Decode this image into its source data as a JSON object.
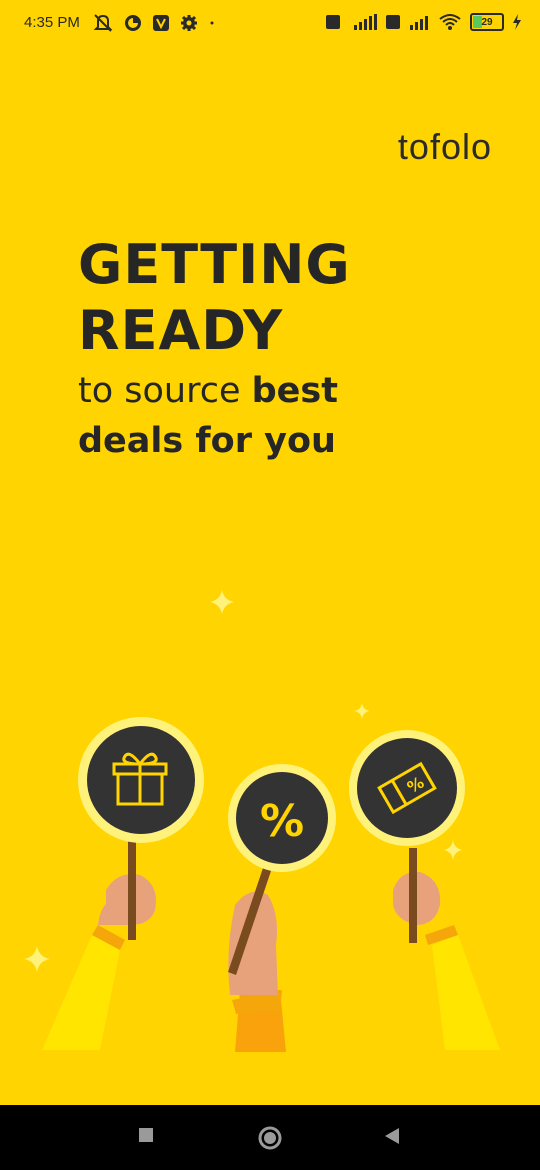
{
  "status_bar": {
    "time": "4:35 PM",
    "battery_level": "29",
    "icons": [
      "mute-icon",
      "app-icon",
      "v-icon",
      "settings-icon",
      "volte-icon",
      "signal-icon",
      "wifi-icon",
      "battery-icon",
      "charging-icon"
    ]
  },
  "brand": {
    "name": "tofolo"
  },
  "headline": {
    "line1": "GETTING",
    "line2": "READY",
    "sub_regular_1": "to source ",
    "sub_bold_1": "best",
    "sub_bold_2": "deals for you"
  },
  "illustration": {
    "signs": [
      "gift-icon",
      "percent-icon",
      "coupon-icon"
    ],
    "percent_symbol": "%"
  },
  "nav": {
    "items": [
      "recent-apps",
      "home",
      "back"
    ]
  },
  "colors": {
    "background": "#FFD400",
    "text": "#262626",
    "sign_dark": "#333333",
    "sign_ring": "#FFF27A",
    "sleeve": "#FFE500",
    "skin": "#E7A27C"
  }
}
